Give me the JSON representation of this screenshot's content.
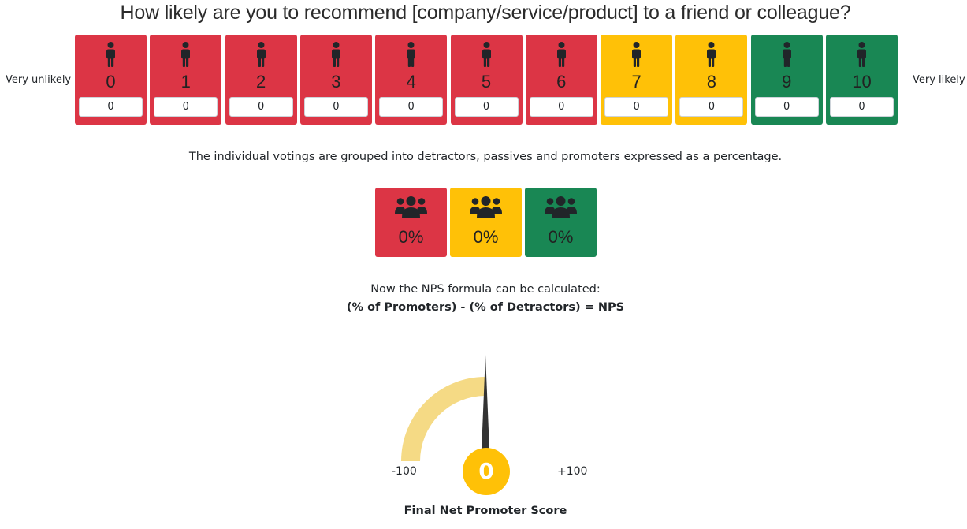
{
  "survey": {
    "question": "How likely are you to recommend [company/service/product] to a friend or colleague?",
    "label_low": "Very unlikely",
    "label_high": "Very likely",
    "scores": [
      {
        "score": "0",
        "votes": "0",
        "group": "detractor"
      },
      {
        "score": "1",
        "votes": "0",
        "group": "detractor"
      },
      {
        "score": "2",
        "votes": "0",
        "group": "detractor"
      },
      {
        "score": "3",
        "votes": "0",
        "group": "detractor"
      },
      {
        "score": "4",
        "votes": "0",
        "group": "detractor"
      },
      {
        "score": "5",
        "votes": "0",
        "group": "detractor"
      },
      {
        "score": "6",
        "votes": "0",
        "group": "detractor"
      },
      {
        "score": "7",
        "votes": "0",
        "group": "passive"
      },
      {
        "score": "8",
        "votes": "0",
        "group": "passive"
      },
      {
        "score": "9",
        "votes": "0",
        "group": "promoter"
      },
      {
        "score": "10",
        "votes": "0",
        "group": "promoter"
      }
    ]
  },
  "grouping": {
    "description": "The individual votings are grouped into detractors, passives and promoters expressed as a percentage.",
    "groups": [
      {
        "key": "detractor",
        "percent": "0%"
      },
      {
        "key": "passive",
        "percent": "0%"
      },
      {
        "key": "promoter",
        "percent": "0%"
      }
    ]
  },
  "formula": {
    "intro": "Now the NPS formula can be calculated:",
    "expression": "(% of Promoters) - (% of Detractors) = NPS"
  },
  "gauge": {
    "min_label": "-100",
    "max_label": "+100",
    "value": 0,
    "score_display": "0",
    "caption": "Final Net Promoter Score"
  },
  "colors": {
    "detractor": "#dc3545",
    "passive": "#ffc107",
    "promoter": "#198754",
    "gauge_arc": "#f5da85",
    "needle": "#333333",
    "icon": "#212529"
  },
  "icons": {
    "vote_card": "person-icon",
    "group_card": "users-icon"
  }
}
